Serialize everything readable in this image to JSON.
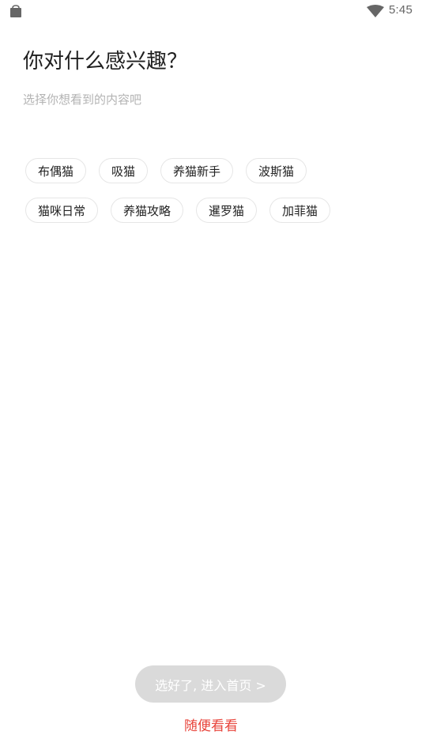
{
  "status_bar": {
    "time": "5:45",
    "left_icon": "shopping-bag-icon",
    "right_icon": "wifi-icon"
  },
  "header": {
    "title": "你对什么感兴趣？",
    "subtitle": "选择你想看到的内容吧"
  },
  "tags": [
    [
      "布偶猫",
      "吸猫",
      "养猫新手",
      "波斯猫"
    ],
    [
      "猫咪日常",
      "养猫攻略",
      "暹罗猫",
      "加菲猫"
    ]
  ],
  "footer": {
    "confirm_label": "选好了, 进入首页 >",
    "skip_label": "随便看看"
  },
  "colors": {
    "accent": "#e8453c",
    "button_disabled": "#dadada",
    "chip_border": "#e6e6e6",
    "subtitle": "#b3b3b3"
  }
}
